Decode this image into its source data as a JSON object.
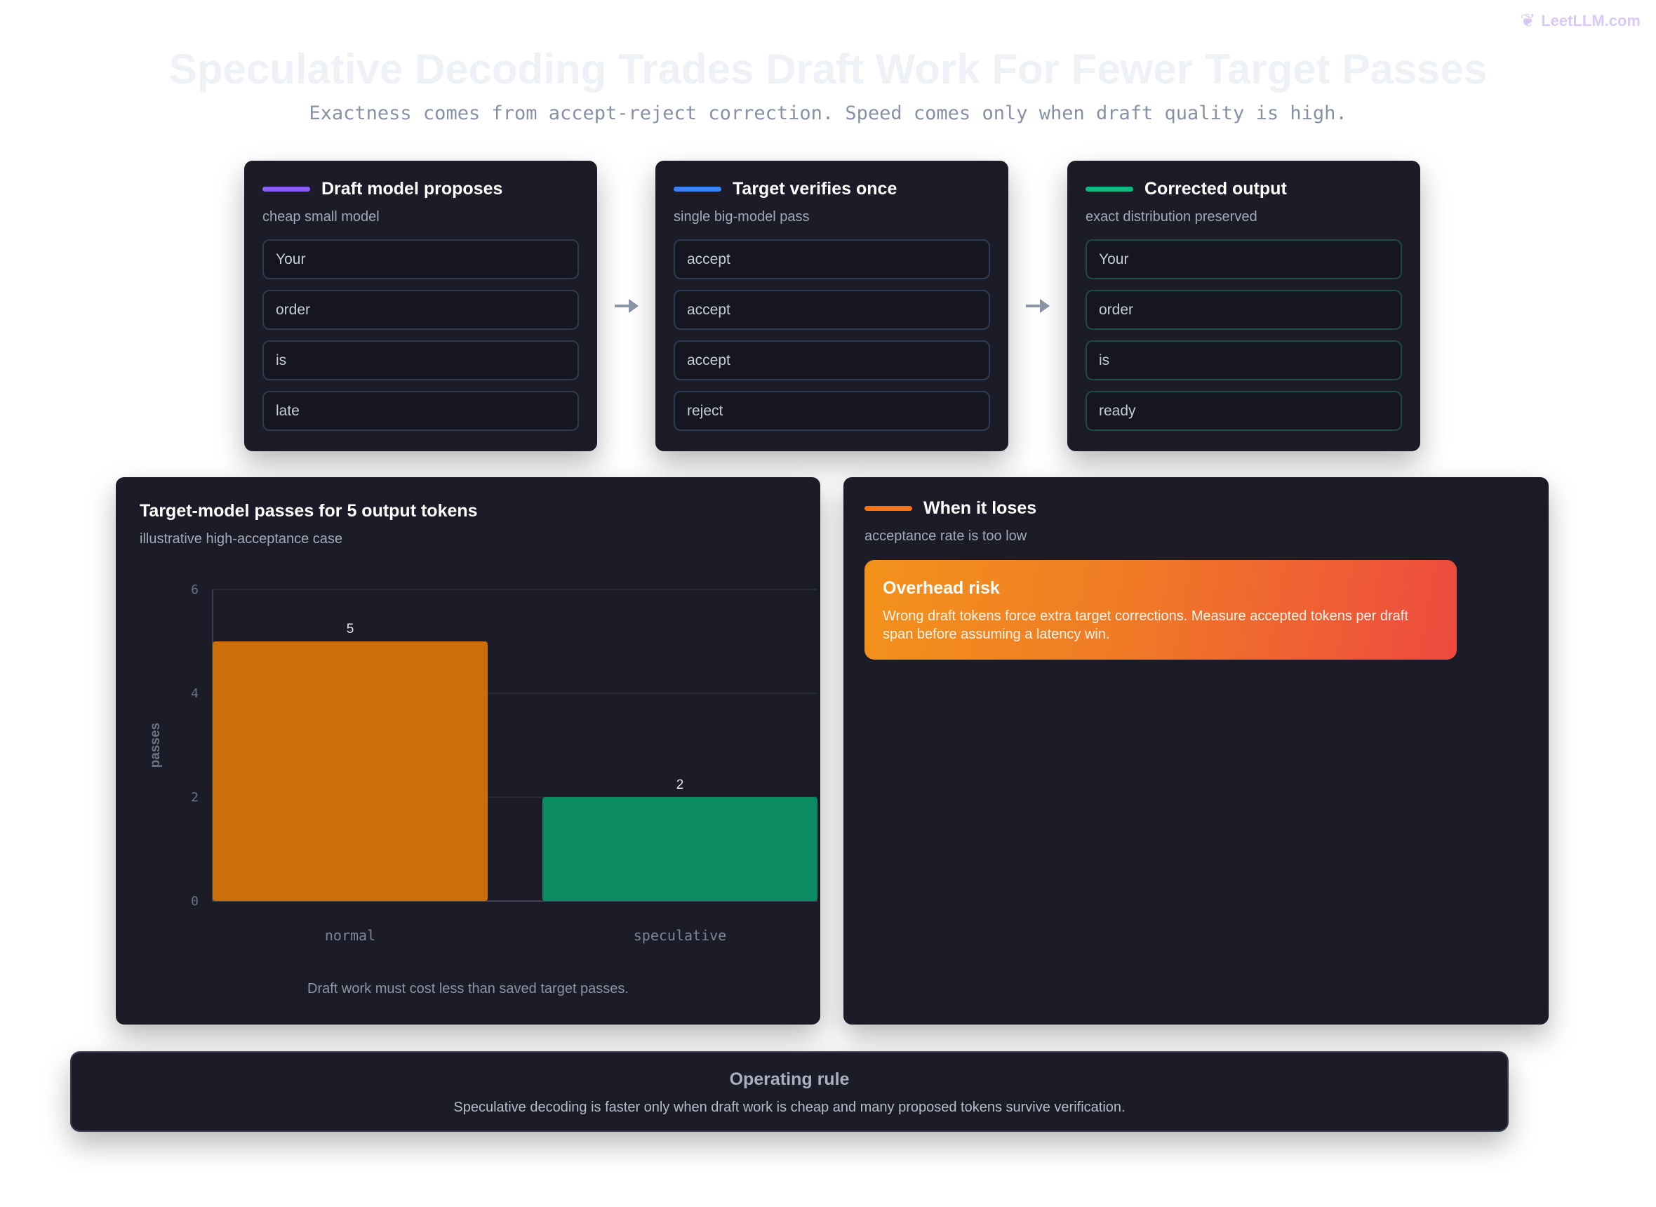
{
  "brand": {
    "name": "LeetLLM.com",
    "icon": "brain-icon"
  },
  "header": {
    "title": "Speculative Decoding Trades Draft Work For Fewer Target Passes",
    "subtitle": "Exactness comes from accept-reject correction. Speed comes only when draft quality is high."
  },
  "stages": [
    {
      "title": "Draft model proposes",
      "subtitle": "cheap small model",
      "accent": "#8b5cf6",
      "tokens": [
        "Your",
        "order",
        "is",
        "late"
      ]
    },
    {
      "title": "Target verifies once",
      "subtitle": "single big-model pass",
      "accent": "#3b82f6",
      "tokens": [
        "accept",
        "accept",
        "accept",
        "reject"
      ]
    },
    {
      "title": "Corrected output",
      "subtitle": "exact distribution preserved",
      "accent": "#10b981",
      "tokens": [
        "Your",
        "order",
        "is",
        "ready"
      ]
    }
  ],
  "chart_panel": {
    "title": "Target-model passes for 5 output tokens",
    "subtitle": "illustrative high-acceptance case",
    "note": "Draft work must cost less than saved target passes."
  },
  "chart_data": {
    "type": "bar",
    "title": "Target-model passes for 5 output tokens",
    "subtitle": "illustrative high-acceptance case",
    "categories": [
      "normal",
      "speculative"
    ],
    "values": [
      5,
      2
    ],
    "colors": [
      "#cc6e0a",
      "#0b8c63"
    ],
    "xlabel": "",
    "ylabel": "passes",
    "ylim": [
      0,
      6
    ],
    "yticks": [
      0,
      2,
      4,
      6
    ],
    "grid": true,
    "data_labels": true
  },
  "risk_panel": {
    "title": "When it loses",
    "subtitle": "acceptance rate is too low",
    "accent": "#f97316",
    "card": {
      "title": "Overhead risk",
      "text": "Wrong draft tokens force extra target corrections. Measure accepted tokens per draft span before assuming a latency win."
    }
  },
  "rule": {
    "title": "Operating rule",
    "text": "Speculative decoding is faster only when draft work is cheap and many proposed tokens survive verification."
  }
}
